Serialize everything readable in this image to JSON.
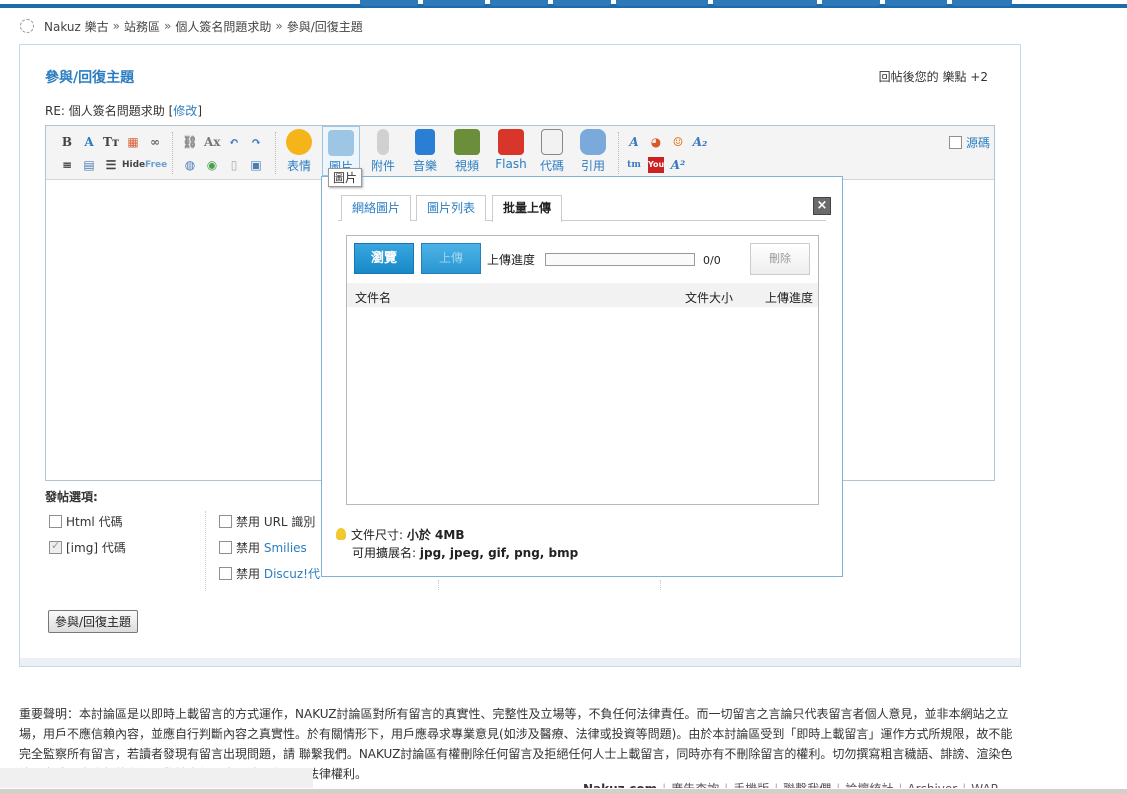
{
  "breadcrumb": {
    "site": "Nakuz 樂古",
    "separator": "»",
    "forum": "站務區",
    "thread": "個人簽名問題求助",
    "current": "參與/回復主題"
  },
  "panel": {
    "title": "參與/回復主題",
    "credits_note": "回帖後您的 樂點 +2",
    "subject_prefix": "RE: 個人簽名問題求助",
    "edit_link": "修改"
  },
  "toolbar": {
    "big_buttons": [
      {
        "label": "表情",
        "icon": "smiley-icon",
        "color": "#f5b51a"
      },
      {
        "label": "圖片",
        "icon": "image-icon",
        "color": "#9cc6e4"
      },
      {
        "label": "附件",
        "icon": "paperclip-icon",
        "color": "#b8b8b8"
      },
      {
        "label": "音樂",
        "icon": "music-note-icon",
        "color": "#2a7fd4"
      },
      {
        "label": "視頻",
        "icon": "film-icon",
        "color": "#6b8e3a"
      },
      {
        "label": "Flash",
        "icon": "flash-icon",
        "color": "#d8362b"
      },
      {
        "label": "代碼",
        "icon": "code-icon",
        "color": "#888888"
      },
      {
        "label": "引用",
        "icon": "quote-bubble-icon",
        "color": "#7aa9dc"
      }
    ],
    "source_label": "源碼",
    "tooltip": "圖片"
  },
  "popup": {
    "tabs": [
      "網絡圖片",
      "圖片列表",
      "批量上傳"
    ],
    "active_tab": "批量上傳",
    "close": "×",
    "browse_label": "瀏覽",
    "upload_label": "上傳",
    "progress_label": "上傳進度",
    "progress_fraction": 0,
    "progress_count": "0/0",
    "delete_label": "刪除",
    "columns": {
      "name": "文件名",
      "size": "文件大小",
      "progress": "上傳進度"
    },
    "size_hint_prefix": "文件尺寸:",
    "size_hint_value": "小於 4MB",
    "ext_hint_prefix": "可用擴展名:",
    "ext_hint_value": "jpg, jpeg, gif, png, bmp"
  },
  "options": {
    "title": "發帖選項:",
    "html_code": "Html 代碼",
    "img_code": "[img] 代碼",
    "url_prefix": "禁用 URL 識別",
    "smilies_prefix": "禁用",
    "smilies_link": "Smilies",
    "discuz_prefix": "禁用",
    "discuz_link": "Discuz!代"
  },
  "submit_label": "參與/回復主題",
  "disclaimer": "重要聲明：本討論區是以即時上載留言的方式運作，NAKUZ討論區對所有留言的真實性、完整性及立場等，不負任何法律責任。而一切留言之言論只代表留言者個人意見，並非本網站之立場，用戶不應信賴內容，並應自行判斷內容之真實性。於有關情形下，用戶應尋求專業意見(如涉及醫療、法律或投資等問題)。由於本討論區受到「即時上載留言」運作方式所規限，故不能完全監察所有留言，若讀者發現有留言出現問題，請 聯繫我們。NAKUZ討論區有權刪除任何留言及拒絕任何人士上載留言，同時亦有不刪除留言的權利。切勿撰寫粗言穢語、誹謗、渲染色情暴力或人身攻擊的言論，敬請自律。本網站保留一切法律權利。",
  "footer": {
    "site": "Nakuz.com",
    "links": [
      "廣告查詢",
      "手機版",
      "聯繫我們",
      "論壇統計",
      "Archiver",
      "WAP"
    ]
  }
}
